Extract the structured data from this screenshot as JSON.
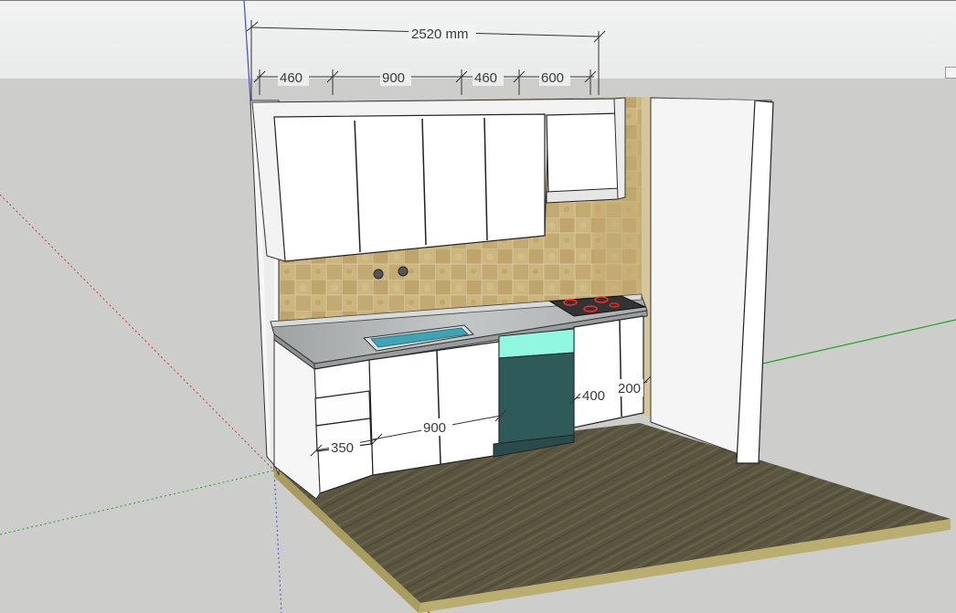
{
  "viewport": {
    "title": "SketchUp 3D kitchen model view"
  },
  "dimensions": {
    "overall": "2520 mm",
    "upper_segments": [
      "460",
      "900",
      "460",
      "600"
    ],
    "base_drawers_width": "350",
    "sink_base_width": "900",
    "dishwasher_side": "400",
    "end_panel": "200"
  },
  "colors": {
    "cabinet_white": "#ffffff",
    "tile": "#c9b27a",
    "counter": "#b9bcbc",
    "dishwasher": "#2f5a5a",
    "dishwasher_panel": "#90f8e0",
    "sink_water": "#3fa4b4",
    "floor": "#5c5840",
    "floor_edge": "#b9ad6f",
    "axis_red": "#c0392b",
    "axis_green": "#22a022",
    "axis_blue": "#3b4fd6"
  }
}
